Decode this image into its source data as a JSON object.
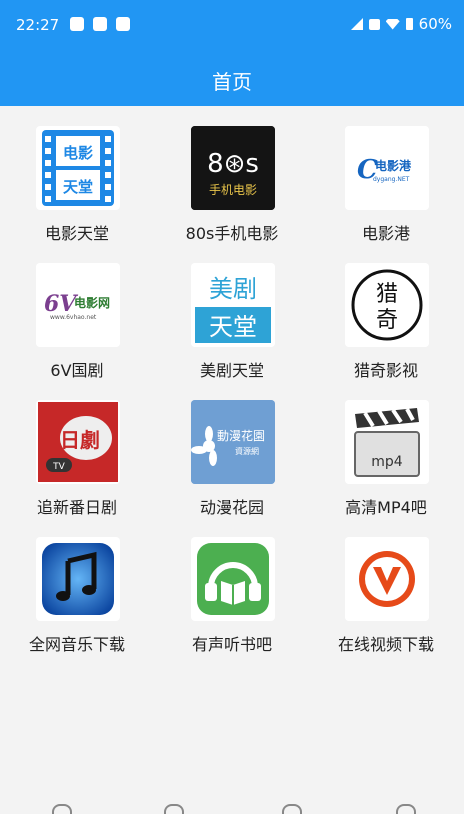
{
  "status_bar": {
    "time": "22:27",
    "battery": "60%"
  },
  "app_bar": {
    "title": "首页"
  },
  "apps": [
    {
      "label": "电影天堂",
      "icon": "film-paradise-icon"
    },
    {
      "label": "80s手机电影",
      "icon": "80s-movie-icon"
    },
    {
      "label": "电影港",
      "icon": "movie-harbor-icon"
    },
    {
      "label": "6V国剧",
      "icon": "6v-drama-icon"
    },
    {
      "label": "美剧天堂",
      "icon": "us-drama-icon"
    },
    {
      "label": "猎奇影视",
      "icon": "lieqi-video-icon"
    },
    {
      "label": "追新番日剧",
      "icon": "japan-drama-icon"
    },
    {
      "label": "动漫花园",
      "icon": "anime-garden-icon"
    },
    {
      "label": "高清MP4吧",
      "icon": "mp4-clapper-icon"
    },
    {
      "label": "全网音乐下载",
      "icon": "music-note-icon"
    },
    {
      "label": "有声听书吧",
      "icon": "audiobook-icon"
    },
    {
      "label": "在线视频下载",
      "icon": "video-download-icon"
    }
  ],
  "icon_text": {
    "film1": "电影",
    "film2": "天堂",
    "s80_top": "8⊛s",
    "s80_bottom": "手机电影",
    "harbor_main": "电影港",
    "harbor_sub": "dygang.NET",
    "v6_main": "电影网",
    "v6_url": "www.6vhao.net",
    "mj1": "美剧",
    "mj2": "天堂",
    "lq1": "猎",
    "lq2": "奇",
    "jd_main": "日劇",
    "jd_tv": "TV",
    "dm_main": "動漫花園",
    "dm_sub": "資源網",
    "mp4": "mp4"
  },
  "colors": {
    "primary": "#2196f3"
  }
}
